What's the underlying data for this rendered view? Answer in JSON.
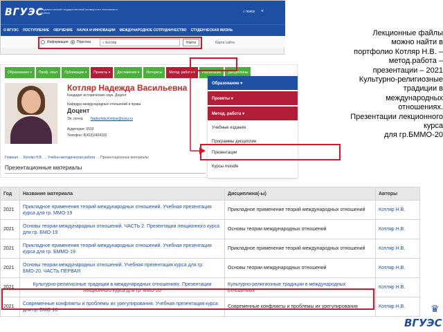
{
  "colors": {
    "site_blue": "#1d4fa3",
    "highlight_red": "#e0102a",
    "tab_green": "#4cae3d",
    "tab_crimson": "#b21d37"
  },
  "site": {
    "logo": "ВГУЭС",
    "univ_name": "Владивостокский государственный университет экономики и сервиса",
    "search_link": "поиск",
    "close": "×",
    "nav": [
      "О ВГУЭС",
      "ПОСТУПЛЕНИЕ",
      "ОБУЧЕНИЕ",
      "НАУКА И ИННОВАЦИИ",
      "МЕЖДУНАРОДНОЕ СОТРУДНИЧЕСТВО",
      "СТУДЕНЧЕСКАЯ ЖИЗНЬ"
    ],
    "search": {
      "radio_info": "Информация",
      "radio_persons": "Персона",
      "value": "Котляр",
      "button": "Найти",
      "map_link": "Карта сайта"
    }
  },
  "profile": {
    "tabs": [
      {
        "label": "Образование ▾",
        "color": "#4cae3d"
      },
      {
        "label": "Проф. опыт",
        "color": "#4cae3d"
      },
      {
        "label": "Публикации ▾",
        "color": "#4cae3d"
      },
      {
        "label": "Проекты ▾",
        "color": "#b21d37"
      },
      {
        "label": "Достижения ▾",
        "color": "#4cae3d"
      },
      {
        "label": "Интересы",
        "color": "#4cae3d"
      },
      {
        "label": "Метод. работа ▾",
        "color": "#b21d37"
      },
      {
        "label": "Расписание",
        "color": "#4cae3d"
      },
      {
        "label": "Дисциплины",
        "color": "#4cae3d"
      }
    ],
    "name": "Котляр Надежда Васильевна",
    "degree": "Кандидат исторических наук, Доцент",
    "dept": "Кафедра международных отношений и права",
    "position": "Доцент",
    "email_label": "Эл. почта:",
    "email": "Nadezhda.Kotlyar@vvsu.ru",
    "room": "Аудитория: 5593",
    "phone": "Телефон: 8(423)2404332",
    "breadcrumbs": [
      "Главная",
      "Котляр Н.В.",
      "Учебно-методическая работа",
      "Презентационные материалы"
    ],
    "section_title": "Презентационные материалы"
  },
  "menu": {
    "items": [
      {
        "label": "Образование ▾",
        "color": "#1d4fa3"
      },
      {
        "label": "Проекты ▾",
        "color": "#b21d37"
      },
      {
        "label": "Метод. работа ▾",
        "color": "#b21d37"
      }
    ],
    "sub": [
      "Учебные издания",
      "Программы дисциплин",
      "Презентации",
      "Курсы moodle"
    ]
  },
  "caption": "Лекционные файлы\nможно найти в\nпортфолио Котляр Н.В. –\nметод.работа –\nпрезентации – 2021\nКультурно-религиозные\nтрадиции в\nмеждународных\nотношениях.\nПрезентации лекционного\nкурса\nдля гр.БММО-20",
  "table": {
    "headers": [
      "Год",
      "Название материала",
      "Дисциплина(-ы)",
      "Авторы"
    ],
    "rows": [
      {
        "year": "2021",
        "title": "Прикладное применение теорий международных отношений. Учебная презентация курса для гр. ММО-19",
        "discipline": "Прикладное применение теорий международных отношений",
        "author": "Котляр Н.В."
      },
      {
        "year": "2021",
        "title": "Основы теории международных отношений. ЧАСТЬ 2. Презентации лекционного курса для гр. БМО-19",
        "discipline": "Основы теории международных отношений",
        "author": "Котляр Н.В."
      },
      {
        "year": "2021",
        "title": "Прикладное применение теорий международных отношений. Учебная презентация курса для гр. БММО-19",
        "discipline": "Прикладное применение теорий международных отношений",
        "author": "Котляр Н.В."
      },
      {
        "year": "2021",
        "title": "Основы теории международных отношений. Учебная презентация курса для гр. БМО-20. ЧАСТЬ ПЕРВАЯ",
        "discipline": "Основы теории международных отношений",
        "author": "Котляр Н.В."
      },
      {
        "year": "2021",
        "title": "Культурно-религиозные традиции в международных отношениях. Презентации лекционного курса для гр. БМО-20",
        "discipline": "Культурно-религиозные традиции в международных отношениях",
        "author": "Котляр Н.В."
      },
      {
        "year": "2021",
        "title": "Современные конфликты и проблемы их урегулирования. Учебная презентация курса для гр. БМО-18",
        "discipline": "Современные конфликты и проблемы их урегулирования",
        "author": "Котляр Н.В."
      }
    ]
  },
  "bottom_logo": "ВГУЭС"
}
